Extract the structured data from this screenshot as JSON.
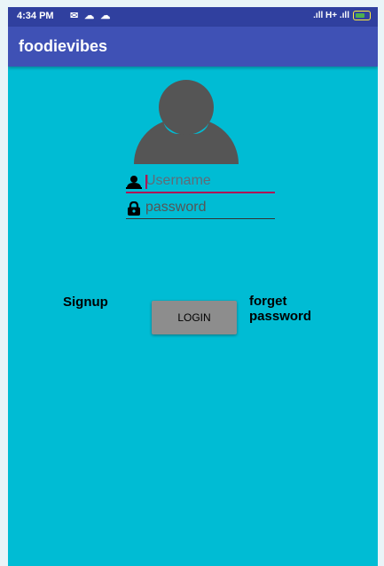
{
  "status_bar": {
    "time": "4:34 PM",
    "left_icons": "✉ ☁ ☁",
    "network": ".ıll H+ .ıll"
  },
  "app_bar": {
    "title": "foodievibes"
  },
  "form": {
    "username_placeholder": "Username",
    "password_placeholder": "password",
    "login_label": "LOGIN",
    "signup_label": "Signup",
    "forget_label": "forget password"
  },
  "colors": {
    "background": "#00bcd4",
    "app_bar": "#3f51b5",
    "status_bar": "#30409f",
    "accent": "#ad1457",
    "button": "#8d8d8d"
  }
}
